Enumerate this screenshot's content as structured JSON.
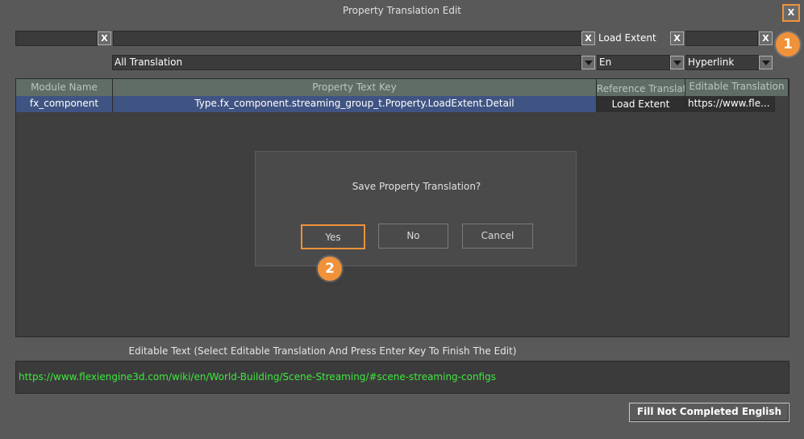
{
  "window": {
    "title": "Property Translation Edit",
    "close_label": "X"
  },
  "filters": {
    "module_filter_value": "",
    "module_clear_label": "X",
    "key_filter_value": "",
    "key_clear_label": "X",
    "reference_filter_value": "Load Extent",
    "reference_clear_label": "X",
    "editable_filter_value": "",
    "editable_clear_label": "X"
  },
  "dropdowns": {
    "translation_mode": "All Translation",
    "language": "En",
    "type": "Hyperlink"
  },
  "table": {
    "headers": [
      "Module Name",
      "Property Text Key",
      "Reference Translation",
      "Editable Translation"
    ],
    "rows": [
      [
        "fx_component",
        "Type.fx_component.streaming_group_t.Property.LoadExtent.Detail",
        "Load Extent",
        "https://www.fle..."
      ]
    ]
  },
  "dialog": {
    "message": "Save Property Translation?",
    "yes_label": "Yes",
    "no_label": "No",
    "cancel_label": "Cancel"
  },
  "editor": {
    "label": "Editable Text (Select Editable Translation And Press Enter Key To Finish The Edit)",
    "value": "https://www.flexiengine3d.com/wiki/en/World-Building/Scene-Streaming/#scene-streaming-configs"
  },
  "footer": {
    "fill_button_label": "Fill Not Completed English"
  },
  "callouts": {
    "badge_1": "1",
    "badge_2": "2"
  },
  "colors": {
    "accent": "#f0923a",
    "selected_row": "#405483",
    "link_text": "#3ee83e"
  }
}
